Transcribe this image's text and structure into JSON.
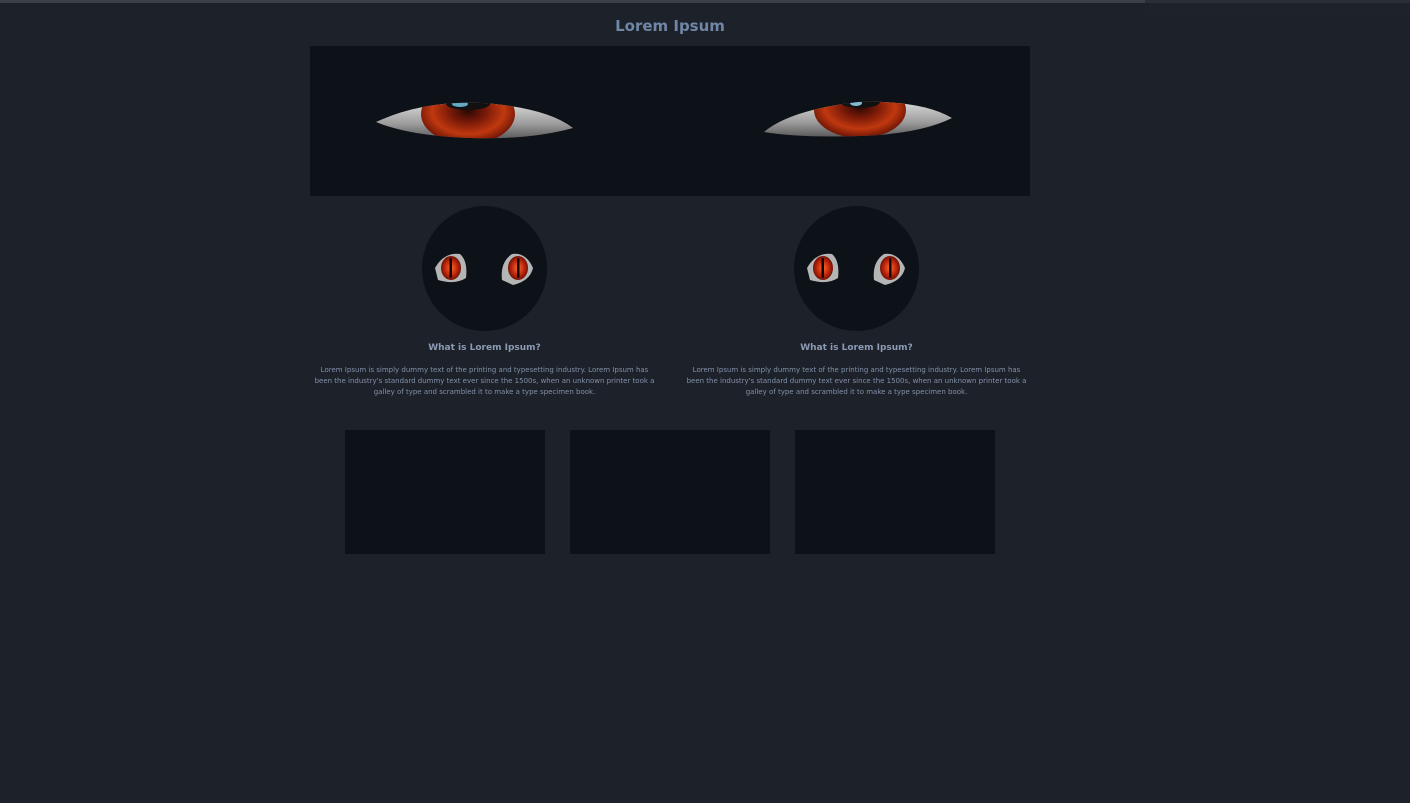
{
  "page": {
    "title": "Lorem Ipsum"
  },
  "hero": {
    "image_name": "red-eyes-banner"
  },
  "cards": [
    {
      "image_name": "cat-eyes",
      "title": "What is Lorem Ipsum?",
      "text": "Lorem Ipsum is simply dummy text of the printing and typesetting industry. Lorem Ipsum has been the industry's standard dummy text ever since the 1500s, when an unknown printer took a galley of type and scrambled it to make a type specimen book."
    },
    {
      "image_name": "cat-eyes",
      "title": "What is Lorem Ipsum?",
      "text": "Lorem Ipsum is simply dummy text of the printing and typesetting industry. Lorem Ipsum has been the industry's standard dummy text ever since the 1500s, when an unknown printer took a galley of type and scrambled it to make a type specimen book."
    }
  ],
  "colors": {
    "background": "#1d212a",
    "panel": "#0d1118",
    "title": "#6f86a6",
    "text": "#8291a8",
    "iris": "#b8330f"
  }
}
